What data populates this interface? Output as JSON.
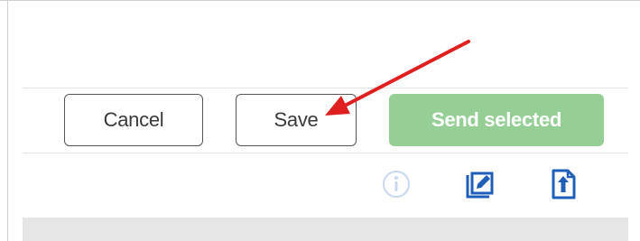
{
  "toolbar": {
    "cancel_label": "Cancel",
    "save_label": "Save",
    "send_selected_label": "Send selected",
    "send_selected_enabled": false
  },
  "icons": {
    "info": "info-icon",
    "edit": "edit-icon",
    "export": "export-icon"
  },
  "colors": {
    "send_button_bg": "#95cf95",
    "icon_blue": "#1f5fb8",
    "info_icon": "#c7d8f0",
    "arrow": "#e02020"
  }
}
